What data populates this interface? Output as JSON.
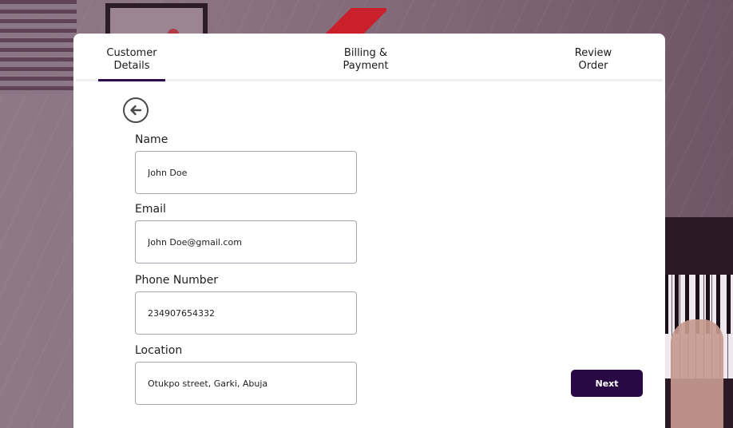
{
  "tabs": [
    {
      "label_line1": "Customer",
      "label_line2": "Details",
      "active": true
    },
    {
      "label_line1": "Billing &",
      "label_line2": "Payment",
      "active": false
    },
    {
      "label_line1": "Review",
      "label_line2": "Order",
      "active": false
    }
  ],
  "icons": {
    "back": "arrow-left-circle-icon"
  },
  "form": {
    "name": {
      "label": "Name",
      "value": "John Doe"
    },
    "email": {
      "label": "Email",
      "value": "John Doe@gmail.com"
    },
    "phone": {
      "label": "Phone Number",
      "value": "234907654332"
    },
    "location": {
      "label": "Location",
      "value": "Otukpo street, Garki, Abuja"
    }
  },
  "actions": {
    "next_label": "Next"
  },
  "colors": {
    "accent": "#2a0845",
    "input_border": "#a5a5b2",
    "background_overlay": "#8a7282"
  }
}
